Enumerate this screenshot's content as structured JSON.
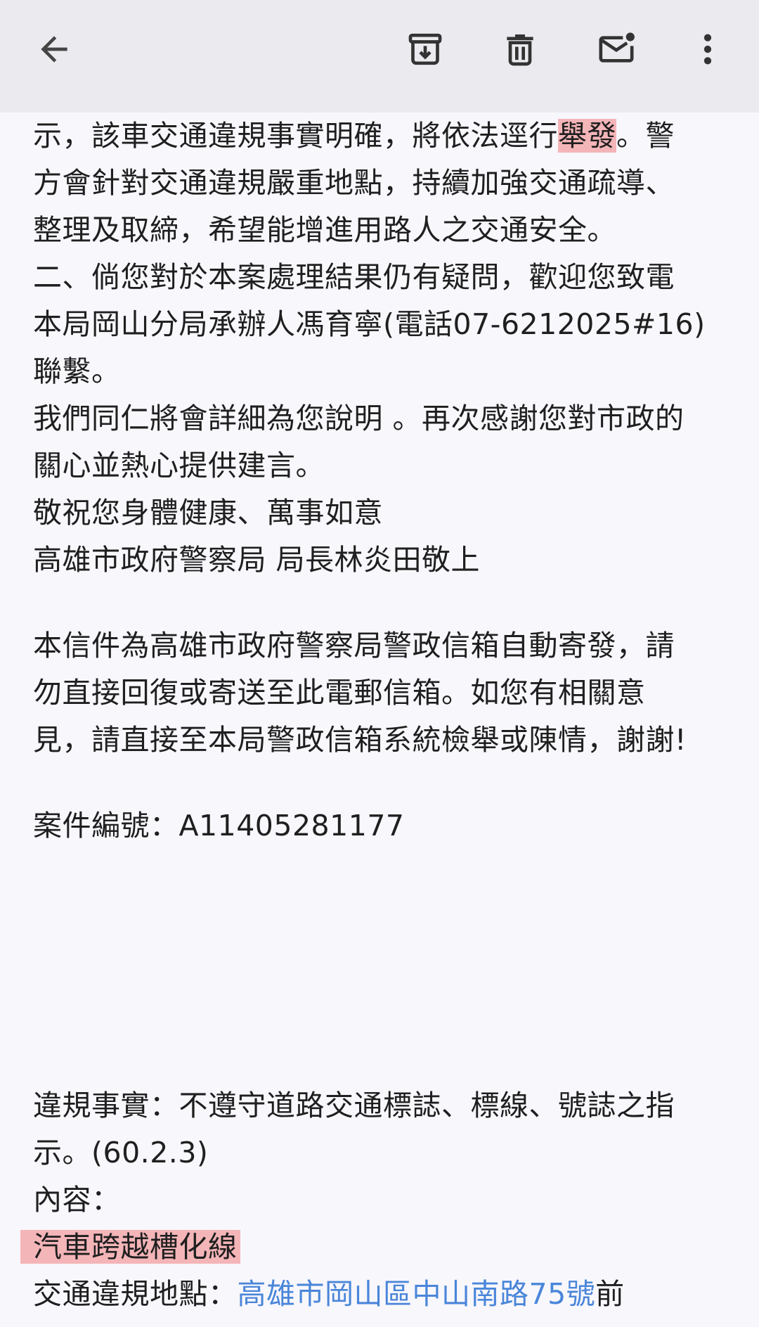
{
  "toolbar": {
    "back_icon": "arrow-left-icon",
    "archive_icon": "archive-icon",
    "delete_icon": "trash-icon",
    "unread_icon": "mark-unread-icon",
    "more_icon": "more-vert-icon"
  },
  "body": {
    "l1_pre": "示，該車交通違規事實明確，將依法逕行",
    "l1_hl": "舉發",
    "l1_post": "。警",
    "l2": "方會針對交通違規嚴重地點，持續加強交通疏導、",
    "l3": "整理及取締，希望能增進用路人之交通安全。",
    "l4": "二、倘您對於本案處理結果仍有疑問，歡迎您致電",
    "l5": "本局岡山分局承辦人馮育寧(電話07-6212025#16)",
    "l6": "聯繫。",
    "l7": "我們同仁將會詳細為您說明 。再次感謝您對市政的",
    "l8": "關心並熱心提供建言。",
    "l9": "敬祝您身體健康、萬事如意",
    "l10": "高雄市政府警察局 局長林炎田敬上",
    "n1": "本信件為高雄市政府警察局警政信箱自動寄發，請",
    "n2": "勿直接回復或寄送至此電郵信箱。如您有相關意",
    "n3": "見，請直接至本局警政信箱系統檢舉或陳情，謝謝!",
    "case_no": "案件編號：A11405281177",
    "v1": "違規事實：不遵守道路交通標誌、標線、號誌之指",
    "v2": "示。(60.2.3)",
    "v3": "內容：",
    "v4": "汽車跨越槽化線",
    "loc_label": "交通違規地點：",
    "loc_link": "高雄市岡山區中山南路75號",
    "loc_post": "前"
  },
  "colors": {
    "highlight": "#f4b5b8",
    "link": "#4a86d9",
    "toolbar_bg": "#ebeaef",
    "page_bg": "#f8f7fc"
  }
}
